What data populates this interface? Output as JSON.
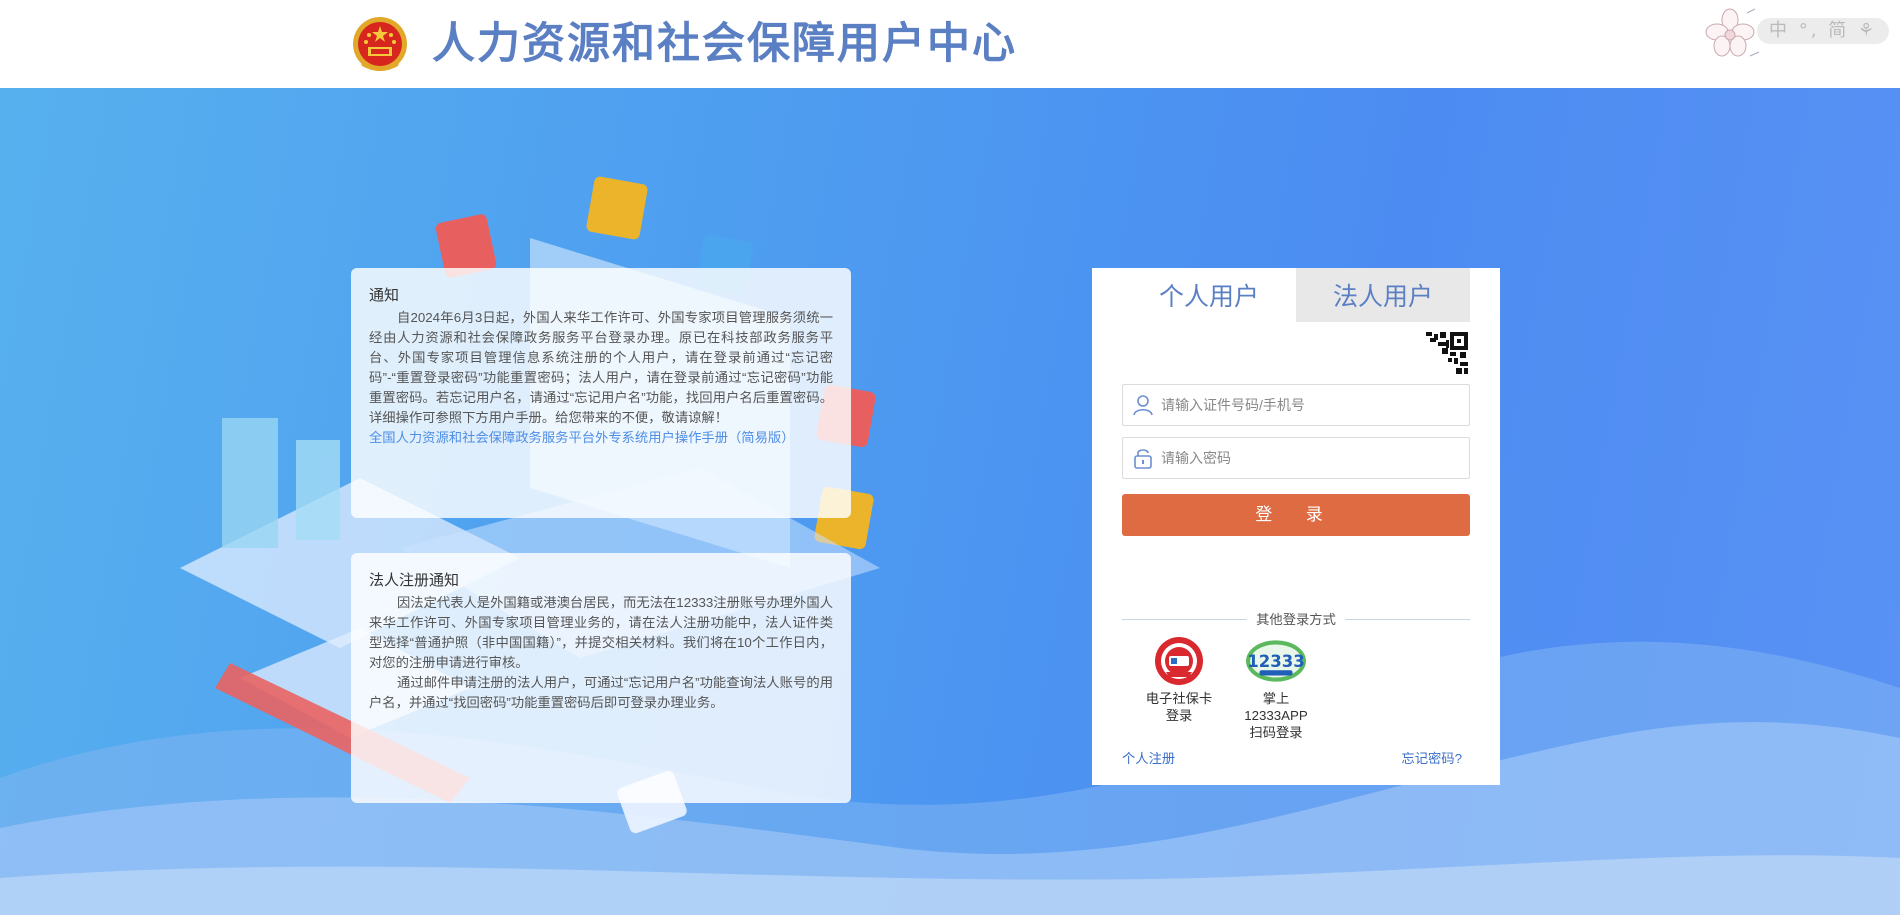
{
  "header": {
    "title": "人力资源和社会保障用户中心",
    "lang": {
      "zh": "中",
      "sep": "°,",
      "simplified": "简"
    }
  },
  "notice": {
    "title": "通知",
    "body": "自2024年6月3日起，外国人来华工作许可、外国专家项目管理服务须统一经由人力资源和社会保障政务服务平台登录办理。原已在科技部政务服务平台、外国专家项目管理信息系统注册的个人用户，请在登录前通过“忘记密码”-“重置登录密码”功能重置密码；法人用户，请在登录前通过“忘记密码”功能重置密码。若忘记用户名，请通过“忘记用户名”功能，找回用户名后重置密码。详细操作可参照下方用户手册。给您带来的不便，敬请谅解！",
    "link": "全国人力资源和社会保障政务服务平台外专系统用户操作手册（简易版）"
  },
  "corp_notice": {
    "title": "法人注册通知",
    "body1": "因法定代表人是外国籍或港澳台居民，而无法在12333注册账号办理外国人来华工作许可、外国专家项目管理业务的，请在法人注册功能中，法人证件类型选择“普通护照（非中国国籍）”，并提交相关材料。我们将在10个工作日内，对您的注册申请进行审核。",
    "body2": "通过邮件申请注册的法人用户，可通过“忘记用户名”功能查询法人账号的用户名，并通过“找回密码”功能重置密码后即可登录办理业务。"
  },
  "login": {
    "tabs": [
      {
        "label": "个人用户"
      },
      {
        "label": "法人用户"
      }
    ],
    "username_placeholder": "请输入证件号码/手机号",
    "password_placeholder": "请输入密码",
    "submit_label": "登 录",
    "other_title": "其他登录方式",
    "alt_methods": [
      {
        "line1": "电子社保卡",
        "line2": "登录",
        "icon": "social-security-card-icon"
      },
      {
        "line1": "掌上12333APP",
        "line2": "扫码登录",
        "icon": "app-12333-icon"
      }
    ],
    "app_logo_text": "12333",
    "register_label": "个人注册",
    "forgot_label": "忘记密码?"
  },
  "colors": {
    "brand_blue": "#5b7fc3",
    "login_button": "#de6b42",
    "link": "#3d6fc9"
  }
}
